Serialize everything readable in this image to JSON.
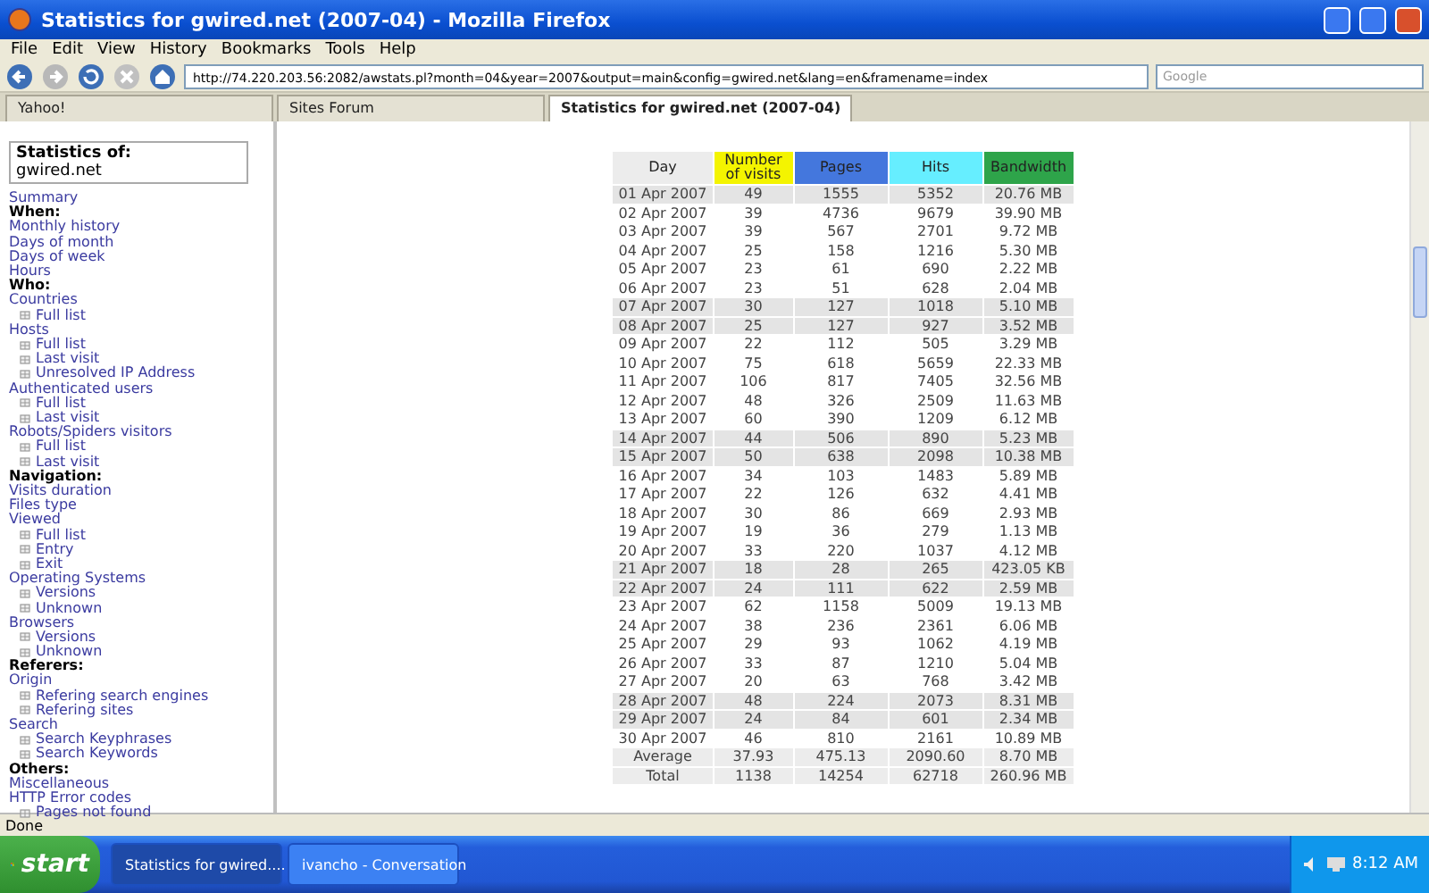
{
  "window": {
    "title": "Statistics for gwired.net (2007-04) - Mozilla Firefox"
  },
  "menu": [
    "File",
    "Edit",
    "View",
    "History",
    "Bookmarks",
    "Tools",
    "Help"
  ],
  "toolbar": {
    "url": "http://74.220.203.56:2082/awstats.pl?month=04&year=2007&output=main&config=gwired.net&lang=en&framename=index",
    "search_placeholder": "Google"
  },
  "tabs": [
    {
      "label": "Yahoo!",
      "selected": false
    },
    {
      "label": "Sites Forum",
      "selected": false
    },
    {
      "label": "Statistics for gwired.net (2007-04)",
      "selected": true
    }
  ],
  "sidebar": {
    "title": "Statistics of:",
    "site": "gwired.net",
    "items": [
      {
        "kind": "link",
        "text": "Summary"
      },
      {
        "kind": "heading",
        "text": "When:"
      },
      {
        "kind": "link",
        "text": "Monthly history"
      },
      {
        "kind": "link",
        "text": "Days of month"
      },
      {
        "kind": "link",
        "text": "Days of week"
      },
      {
        "kind": "link",
        "text": "Hours"
      },
      {
        "kind": "heading",
        "text": "Who:"
      },
      {
        "kind": "link",
        "text": "Countries",
        "children": [
          {
            "text": "Full list"
          }
        ]
      },
      {
        "kind": "link",
        "text": "Hosts",
        "children": [
          {
            "text": "Full list"
          },
          {
            "text": "Last visit"
          },
          {
            "text": "Unresolved IP Address"
          }
        ]
      },
      {
        "kind": "link",
        "text": "Authenticated users",
        "children": [
          {
            "text": "Full list"
          },
          {
            "text": "Last visit"
          }
        ]
      },
      {
        "kind": "link",
        "text": "Robots/Spiders visitors",
        "children": [
          {
            "text": "Full list"
          },
          {
            "text": "Last visit"
          }
        ]
      },
      {
        "kind": "heading",
        "text": "Navigation:"
      },
      {
        "kind": "link",
        "text": "Visits duration"
      },
      {
        "kind": "link",
        "text": "Files type"
      },
      {
        "kind": "link",
        "text": "Viewed",
        "children": [
          {
            "text": "Full list"
          },
          {
            "text": "Entry"
          },
          {
            "text": "Exit"
          }
        ]
      },
      {
        "kind": "link",
        "text": "Operating Systems",
        "children": [
          {
            "text": "Versions"
          },
          {
            "text": "Unknown"
          }
        ]
      },
      {
        "kind": "link",
        "text": "Browsers",
        "children": [
          {
            "text": "Versions"
          },
          {
            "text": "Unknown"
          }
        ]
      },
      {
        "kind": "heading",
        "text": "Referers:"
      },
      {
        "kind": "link",
        "text": "Origin",
        "children": [
          {
            "text": "Refering search engines"
          },
          {
            "text": "Refering sites"
          }
        ]
      },
      {
        "kind": "link",
        "text": "Search",
        "children": [
          {
            "text": "Search Keyphrases"
          },
          {
            "text": "Search Keywords"
          }
        ]
      },
      {
        "kind": "heading",
        "text": "Others:"
      },
      {
        "kind": "link",
        "text": "Miscellaneous"
      },
      {
        "kind": "link",
        "text": "HTTP Error codes",
        "children": [
          {
            "text": "Pages not found"
          }
        ]
      }
    ]
  },
  "table": {
    "columns": [
      {
        "label": "Day",
        "color": "#ececec"
      },
      {
        "label": "Number of visits",
        "color": "#f4f400"
      },
      {
        "label": "Pages",
        "color": "#4477dd"
      },
      {
        "label": "Hits",
        "color": "#66eeff"
      },
      {
        "label": "Bandwidth",
        "color": "#2ea44a"
      }
    ],
    "rows": [
      {
        "day": "01 Apr 2007",
        "visits": "49",
        "pages": "1555",
        "hits": "5352",
        "bandwidth": "20.76 MB",
        "weekend": true
      },
      {
        "day": "02 Apr 2007",
        "visits": "39",
        "pages": "4736",
        "hits": "9679",
        "bandwidth": "39.90 MB",
        "weekend": false
      },
      {
        "day": "03 Apr 2007",
        "visits": "39",
        "pages": "567",
        "hits": "2701",
        "bandwidth": "9.72 MB",
        "weekend": false
      },
      {
        "day": "04 Apr 2007",
        "visits": "25",
        "pages": "158",
        "hits": "1216",
        "bandwidth": "5.30 MB",
        "weekend": false
      },
      {
        "day": "05 Apr 2007",
        "visits": "23",
        "pages": "61",
        "hits": "690",
        "bandwidth": "2.22 MB",
        "weekend": false
      },
      {
        "day": "06 Apr 2007",
        "visits": "23",
        "pages": "51",
        "hits": "628",
        "bandwidth": "2.04 MB",
        "weekend": false
      },
      {
        "day": "07 Apr 2007",
        "visits": "30",
        "pages": "127",
        "hits": "1018",
        "bandwidth": "5.10 MB",
        "weekend": true
      },
      {
        "day": "08 Apr 2007",
        "visits": "25",
        "pages": "127",
        "hits": "927",
        "bandwidth": "3.52 MB",
        "weekend": true
      },
      {
        "day": "09 Apr 2007",
        "visits": "22",
        "pages": "112",
        "hits": "505",
        "bandwidth": "3.29 MB",
        "weekend": false
      },
      {
        "day": "10 Apr 2007",
        "visits": "75",
        "pages": "618",
        "hits": "5659",
        "bandwidth": "22.33 MB",
        "weekend": false
      },
      {
        "day": "11 Apr 2007",
        "visits": "106",
        "pages": "817",
        "hits": "7405",
        "bandwidth": "32.56 MB",
        "weekend": false
      },
      {
        "day": "12 Apr 2007",
        "visits": "48",
        "pages": "326",
        "hits": "2509",
        "bandwidth": "11.63 MB",
        "weekend": false
      },
      {
        "day": "13 Apr 2007",
        "visits": "60",
        "pages": "390",
        "hits": "1209",
        "bandwidth": "6.12 MB",
        "weekend": false
      },
      {
        "day": "14 Apr 2007",
        "visits": "44",
        "pages": "506",
        "hits": "890",
        "bandwidth": "5.23 MB",
        "weekend": true
      },
      {
        "day": "15 Apr 2007",
        "visits": "50",
        "pages": "638",
        "hits": "2098",
        "bandwidth": "10.38 MB",
        "weekend": true
      },
      {
        "day": "16 Apr 2007",
        "visits": "34",
        "pages": "103",
        "hits": "1483",
        "bandwidth": "5.89 MB",
        "weekend": false
      },
      {
        "day": "17 Apr 2007",
        "visits": "22",
        "pages": "126",
        "hits": "632",
        "bandwidth": "4.41 MB",
        "weekend": false
      },
      {
        "day": "18 Apr 2007",
        "visits": "30",
        "pages": "86",
        "hits": "669",
        "bandwidth": "2.93 MB",
        "weekend": false
      },
      {
        "day": "19 Apr 2007",
        "visits": "19",
        "pages": "36",
        "hits": "279",
        "bandwidth": "1.13 MB",
        "weekend": false
      },
      {
        "day": "20 Apr 2007",
        "visits": "33",
        "pages": "220",
        "hits": "1037",
        "bandwidth": "4.12 MB",
        "weekend": false
      },
      {
        "day": "21 Apr 2007",
        "visits": "18",
        "pages": "28",
        "hits": "265",
        "bandwidth": "423.05 KB",
        "weekend": true
      },
      {
        "day": "22 Apr 2007",
        "visits": "24",
        "pages": "111",
        "hits": "622",
        "bandwidth": "2.59 MB",
        "weekend": true
      },
      {
        "day": "23 Apr 2007",
        "visits": "62",
        "pages": "1158",
        "hits": "5009",
        "bandwidth": "19.13 MB",
        "weekend": false
      },
      {
        "day": "24 Apr 2007",
        "visits": "38",
        "pages": "236",
        "hits": "2361",
        "bandwidth": "6.06 MB",
        "weekend": false
      },
      {
        "day": "25 Apr 2007",
        "visits": "29",
        "pages": "93",
        "hits": "1062",
        "bandwidth": "4.19 MB",
        "weekend": false
      },
      {
        "day": "26 Apr 2007",
        "visits": "33",
        "pages": "87",
        "hits": "1210",
        "bandwidth": "5.04 MB",
        "weekend": false
      },
      {
        "day": "27 Apr 2007",
        "visits": "20",
        "pages": "63",
        "hits": "768",
        "bandwidth": "3.42 MB",
        "weekend": false
      },
      {
        "day": "28 Apr 2007",
        "visits": "48",
        "pages": "224",
        "hits": "2073",
        "bandwidth": "8.31 MB",
        "weekend": true
      },
      {
        "day": "29 Apr 2007",
        "visits": "24",
        "pages": "84",
        "hits": "601",
        "bandwidth": "2.34 MB",
        "weekend": true
      },
      {
        "day": "30 Apr 2007",
        "visits": "46",
        "pages": "810",
        "hits": "2161",
        "bandwidth": "10.89 MB",
        "weekend": false
      }
    ],
    "footer": [
      {
        "day": "Average",
        "visits": "37.93",
        "pages": "475.13",
        "hits": "2090.60",
        "bandwidth": "8.70 MB"
      },
      {
        "day": "Total",
        "visits": "1138",
        "pages": "14254",
        "hits": "62718",
        "bandwidth": "260.96 MB"
      }
    ]
  },
  "status_bar": {
    "text": "Done"
  },
  "taskbar": {
    "start": "start",
    "tasks": [
      {
        "label": "Statistics for gwired....",
        "selected": true
      },
      {
        "label": "ivancho - Conversation",
        "selected": false
      }
    ],
    "clock": "8:12 AM"
  }
}
